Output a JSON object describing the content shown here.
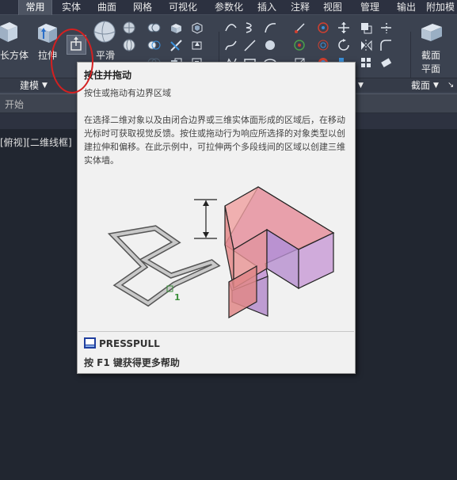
{
  "tabs": [
    "常用",
    "实体",
    "曲面",
    "网格",
    "可视化",
    "参数化",
    "插入",
    "注释",
    "视图",
    "管理",
    "输出",
    "附加模"
  ],
  "ribbon": {
    "box_label": "长方体",
    "extrude_label": "拉伸",
    "smooth_label": "平滑",
    "section_plane_label_1": "截面",
    "section_plane_label_2": "平面"
  },
  "panels": {
    "modeling": "建模",
    "section": "截面"
  },
  "doc": {
    "start_tab": "开始",
    "viewport_label": "[俯视][二维线框]"
  },
  "tooltip": {
    "title": "按住并拖动",
    "subtitle": "按住或拖动有边界区域",
    "description": "在选择二维对象以及由闭合边界或三维实体面形成的区域后，在移动光标时可获取视觉反馈。按住或拖动行为响应所选择的对象类型以创建拉伸和偏移。在此示例中，可拉伸两个多段线间的区域以创建三维实体墙。",
    "illustration_marker": "1",
    "command": "PRESSPULL",
    "help": "按 F1 键获得更多帮助"
  },
  "colors": {
    "highlight_circle": "#d42020",
    "accent_tab": "#4d5462"
  }
}
